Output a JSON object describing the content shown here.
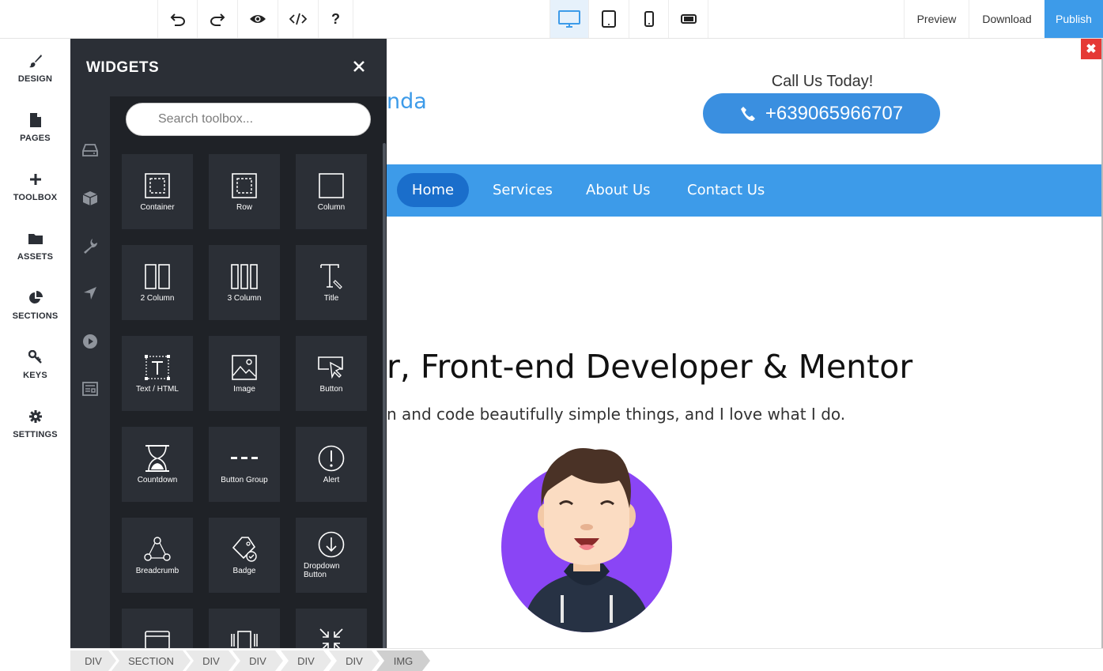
{
  "toolbar": {
    "undo_icon": "undo-icon",
    "redo_icon": "redo-icon",
    "preview_icon": "eye-icon",
    "code_icon": "code-icon",
    "help_icon": "question-icon",
    "devices": [
      "desktop-icon",
      "tablet-icon",
      "mobile-icon",
      "mobile-landscape-icon"
    ],
    "active_device": "desktop",
    "preview_label": "Preview",
    "download_label": "Download",
    "publish_label": "Publish",
    "accent": "#3d9be9"
  },
  "rail": {
    "items": [
      {
        "label": "DESIGN",
        "icon": "brush-icon"
      },
      {
        "label": "PAGES",
        "icon": "page-icon"
      },
      {
        "label": "TOOLBOX",
        "icon": "plus-icon"
      },
      {
        "label": "ASSETS",
        "icon": "folder-icon"
      },
      {
        "label": "SECTIONS",
        "icon": "pie-icon"
      },
      {
        "label": "KEYS",
        "icon": "key-icon"
      },
      {
        "label": "SETTINGS",
        "icon": "gear-icon"
      }
    ]
  },
  "widgets": {
    "title": "WIDGETS",
    "search_placeholder": "Search toolbox...",
    "tabs": [
      "drive-icon",
      "cube-icon",
      "wrench-icon",
      "location-arrow-icon",
      "play-icon",
      "newspaper-icon"
    ],
    "tiles": [
      {
        "label": "Container",
        "icon": "container-icon"
      },
      {
        "label": "Row",
        "icon": "row-icon"
      },
      {
        "label": "Column",
        "icon": "column-icon"
      },
      {
        "label": "2 Column",
        "icon": "two-column-icon"
      },
      {
        "label": "3 Column",
        "icon": "three-column-icon"
      },
      {
        "label": "Title",
        "icon": "title-icon"
      },
      {
        "label": "Text / HTML",
        "icon": "text-html-icon"
      },
      {
        "label": "Image",
        "icon": "image-icon"
      },
      {
        "label": "Button",
        "icon": "button-icon"
      },
      {
        "label": "Countdown",
        "icon": "hourglass-icon"
      },
      {
        "label": "Button Group",
        "icon": "button-group-icon"
      },
      {
        "label": "Alert",
        "icon": "alert-icon"
      },
      {
        "label": "Breadcrumb",
        "icon": "breadcrumb-icon"
      },
      {
        "label": "Badge",
        "icon": "badge-icon"
      },
      {
        "label": "Dropdown Button",
        "icon": "dropdown-icon"
      },
      {
        "label": "",
        "icon": "card-icon"
      },
      {
        "label": "",
        "icon": "carousel-icon"
      },
      {
        "label": "",
        "icon": "collapse-icon"
      }
    ]
  },
  "site": {
    "logo_fragment": "nda",
    "call_today": "Call Us Today!",
    "phone": "+639065966707",
    "nav": [
      "Home",
      "Services",
      "About Us",
      "Contact Us"
    ],
    "active_nav": "Home",
    "hero_title": "r, Front-end Developer & Mentor",
    "hero_subtitle": "n and code beautifully simple things, and I love what I do.",
    "brand_color": "#3d9be9"
  },
  "breadcrumb": [
    "DIV",
    "SECTION",
    "DIV",
    "DIV",
    "DIV",
    "DIV",
    "IMG"
  ]
}
